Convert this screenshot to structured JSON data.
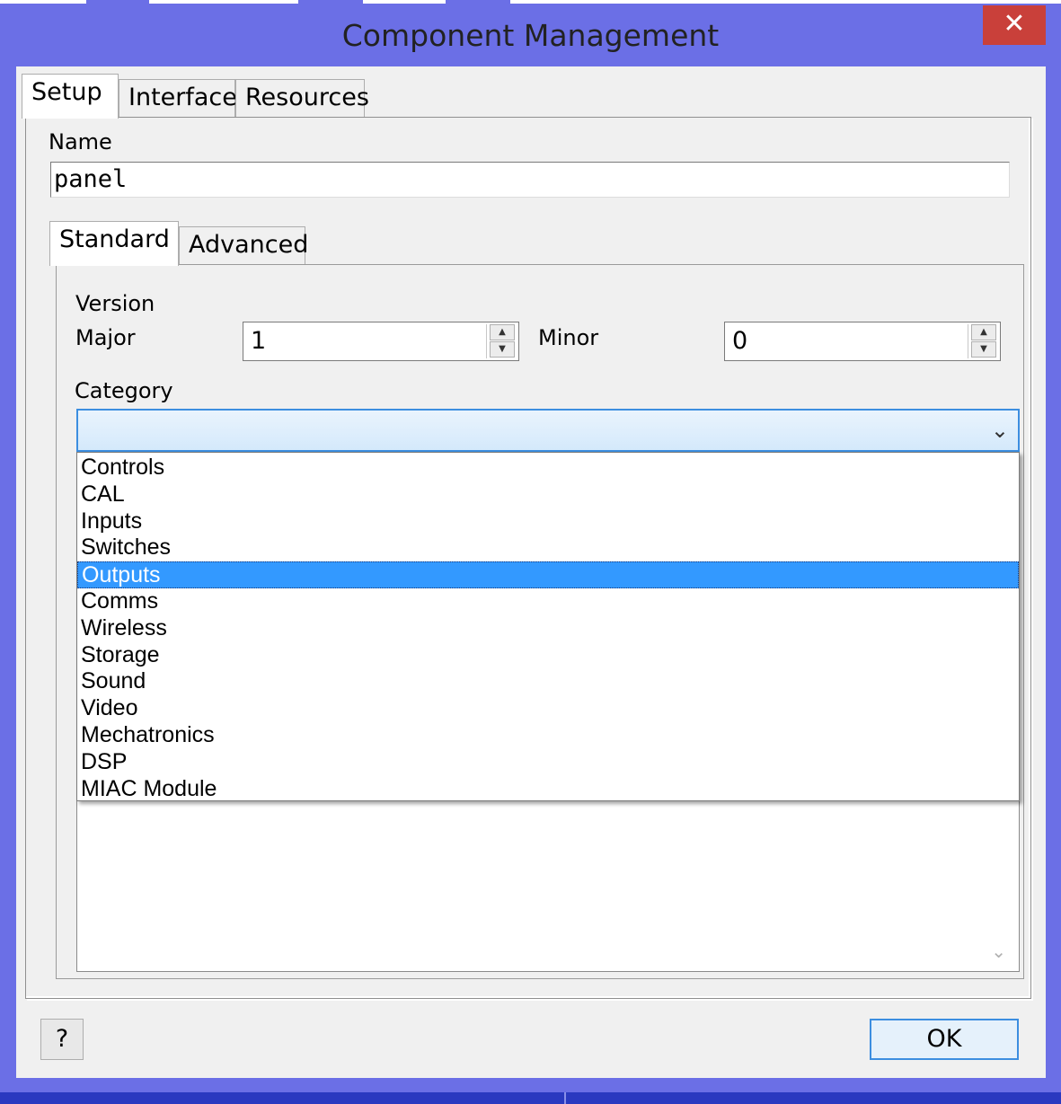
{
  "window": {
    "title": "Component Management",
    "close_glyph": "✕"
  },
  "tabs": {
    "setup": "Setup",
    "interface": "Interface",
    "resources": "Resources"
  },
  "name": {
    "label": "Name",
    "value": "panel"
  },
  "subtabs": {
    "standard": "Standard",
    "advanced": "Advanced"
  },
  "version": {
    "label": "Version",
    "major_label": "Major",
    "major_value": "1",
    "minor_label": "Minor",
    "minor_value": "0"
  },
  "category": {
    "label": "Category",
    "selected": "",
    "options": [
      "Controls",
      "CAL",
      "Inputs",
      "Switches",
      "Outputs",
      "Comms",
      "Wireless",
      "Storage",
      "Sound",
      "Video",
      "Mechatronics",
      "DSP",
      "MIAC Module"
    ],
    "highlighted": "Outputs"
  },
  "icons": {
    "dropdown": "chevron-down-icon",
    "spin_up": "arrow-up-icon",
    "spin_down": "arrow-down-icon",
    "close": "close-icon"
  },
  "buttons": {
    "help": "?",
    "ok": "OK"
  },
  "colors": {
    "titlebar": "#6b6fe6",
    "close": "#c9403a",
    "selection": "#3399ff",
    "focus": "#3c8ee0"
  }
}
